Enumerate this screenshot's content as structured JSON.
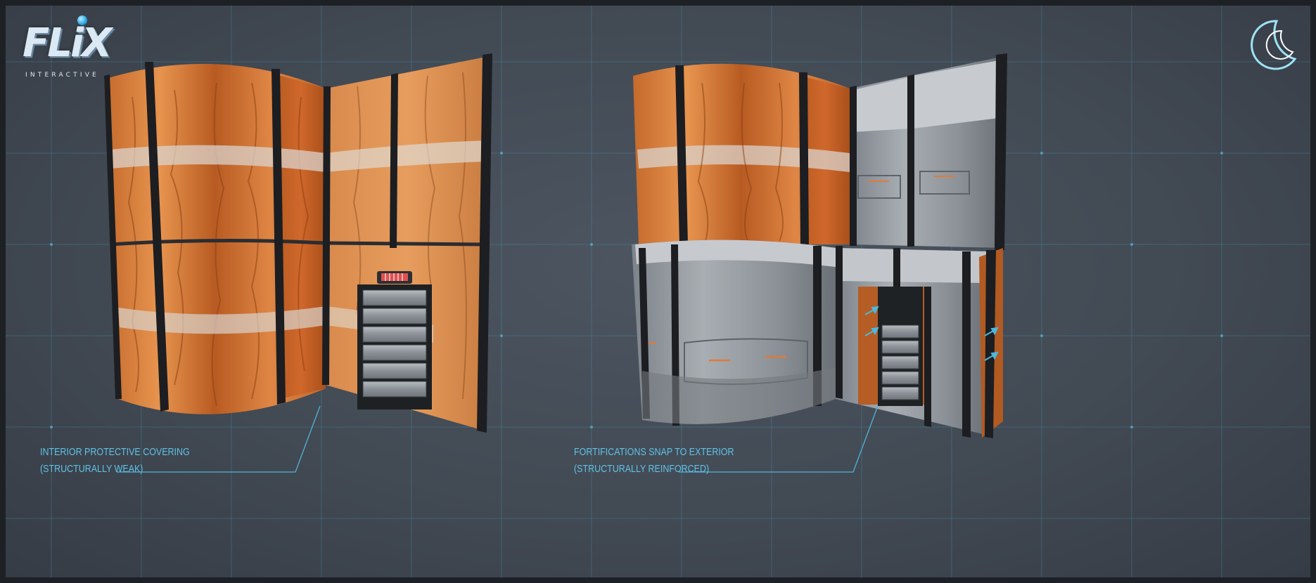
{
  "brand": {
    "logo_text": "FLiX",
    "logo_subtext": "INTERACTIVE"
  },
  "captions": {
    "left": {
      "line1": "INTERIOR PROTECTIVE COVERING",
      "line2": "(STRUCTURALLY WEAK)"
    },
    "right": {
      "line1": "FORTIFICATIONS SNAP TO EXTERIOR",
      "line2": "(STRUCTURALLY REINFORCED)"
    }
  },
  "icons": {
    "studio": "crescent-moon-icon",
    "arrows": "arrow-icon"
  },
  "colors": {
    "background": "#434b55",
    "grid": "#3fb6d6",
    "caption": "#5fc2e6",
    "covering": "#d77a3a",
    "armor": "#8d9297"
  }
}
